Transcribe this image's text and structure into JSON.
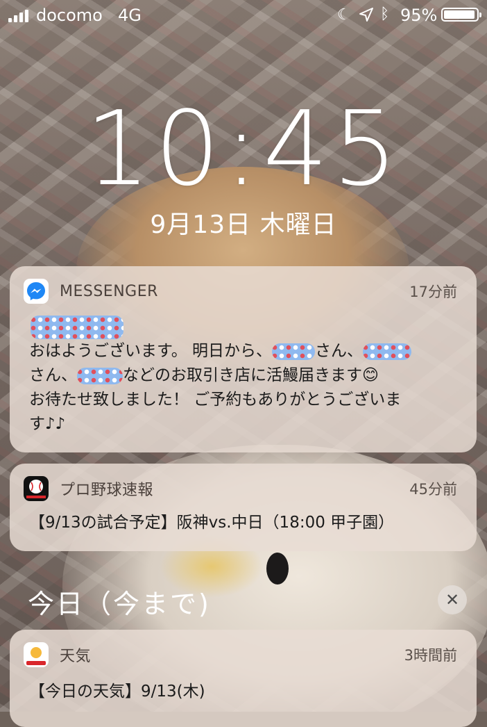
{
  "status_bar": {
    "carrier": "docomo",
    "network": "4G",
    "battery_percent": "95%",
    "battery_level": 0.95,
    "icons": [
      "signal-bars-icon",
      "moon-icon",
      "location-arrow-icon",
      "bluetooth-icon",
      "battery-icon"
    ]
  },
  "lock_screen": {
    "time": "10:45",
    "date": "9月13日 木曜日"
  },
  "notifications": [
    {
      "app": "MESSENGER",
      "icon": "messenger-icon",
      "time_ago": "17分前",
      "message": {
        "line1_a": "おはようございます。 明日から、",
        "line1_b": "さん、",
        "line2_a": "さん、",
        "line2_b": "などのお取引き店に活鰻届きます",
        "line2_emoji": "😊",
        "line3": "お待たせ致しました！ ご予約もありがとうございま",
        "line4": "す♪♪"
      }
    },
    {
      "app": "プロ野球速報",
      "icon": "sports-baseball-icon",
      "time_ago": "45分前",
      "message": "【9/13の試合予定】阪神vs.中日（18:00 甲子園）"
    }
  ],
  "section": {
    "title": "今日（今まで)",
    "clear_label": "✕"
  },
  "weather_notification": {
    "app": "天気",
    "icon": "yahoo-weather-icon",
    "time_ago": "3時間前",
    "line1": "【今日の天気】9/13(木)"
  },
  "colors": {
    "messenger_blue": "#1f87f5",
    "card_background": "#e8dcd4",
    "redaction_blue": "#8fb9ef",
    "redaction_red_dot": "#e0505c"
  }
}
